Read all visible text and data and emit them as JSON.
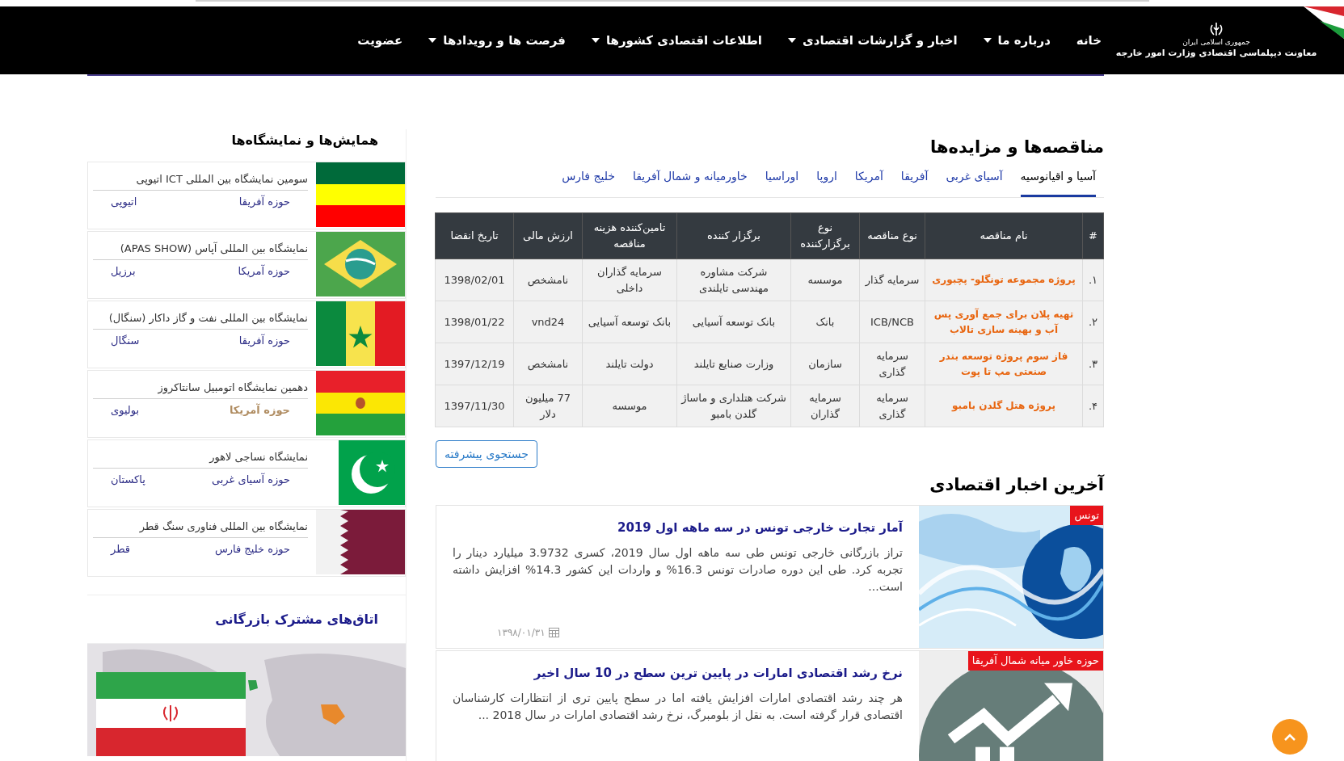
{
  "header": {
    "logo": {
      "line_1": "جمهوری اسلامی ایران",
      "line_2": "معاونت دیپلماسی اقتصادی وزارت امور خارجه"
    },
    "nav": [
      {
        "label": "خانه",
        "has_menu": false
      },
      {
        "label": "درباره ما",
        "has_menu": true
      },
      {
        "label": "اخبار و گزارشات اقتصادی",
        "has_menu": true
      },
      {
        "label": "اطلاعات اقتصادی کشورها",
        "has_menu": true
      },
      {
        "label": "فرصت ها و رویدادها",
        "has_menu": true
      },
      {
        "label": "عضویت",
        "has_menu": false
      }
    ]
  },
  "tenders": {
    "title": "مناقصه‌ها و مزایده‌ها",
    "tabs": [
      {
        "label": "آسیا و اقیانوسیه",
        "selected": true
      },
      {
        "label": "آسیای غربی",
        "selected": false
      },
      {
        "label": "آفریقا",
        "selected": false
      },
      {
        "label": "آمریکا",
        "selected": false
      },
      {
        "label": "اروپا",
        "selected": false
      },
      {
        "label": "اوراسیا",
        "selected": false
      },
      {
        "label": "خاورمیانه و شمال آفریقا",
        "selected": false
      },
      {
        "label": "خلیج فارس",
        "selected": false
      }
    ],
    "columns": [
      "#",
      "نام مناقصه",
      "نوع مناقصه",
      "نوع برگزارکننده",
      "برگزار کننده",
      "تامین‌کننده هزینه مناقصه",
      "ارزش مالی",
      "تاریخ انقضا"
    ],
    "rows": [
      {
        "number": "۱.",
        "name": "پروژه مجموعه تونگلو- پچبوری",
        "type": "سرمایه گذار",
        "organizer_type": "موسسه",
        "organizer": "شرکت مشاوره مهندسی تایلندی",
        "funder": "سرمایه گذاران داخلی",
        "value": "نامشخص",
        "expiry": "1398/02/01"
      },
      {
        "number": "۲.",
        "name": "تهیه پلان برای جمع آوری پس آب و بهینه سازی تالاب",
        "type": "ICB/NCB",
        "organizer_type": "بانک",
        "organizer": "بانک توسعه آسیایی",
        "funder": "بانک توسعه آسیایی",
        "value": "vnd24",
        "expiry": "1398/01/22"
      },
      {
        "number": "۳.",
        "name": "فاز سوم پروژه توسعه بندر صنعتی مپ تا پوت",
        "type": "سرمایه گذاری",
        "organizer_type": "سازمان",
        "organizer": "وزارت صنایع تایلند",
        "funder": "دولت تایلند",
        "value": "نامشخص",
        "expiry": "1397/12/19"
      },
      {
        "number": "۴.",
        "name": "پروژه هتل گلدن بامبو",
        "type": "سرمایه گذاری",
        "organizer_type": "سرمایه گذاران",
        "organizer": "شرکت هتلداری و ماساژ گلدن بامبو",
        "funder": "موسسه",
        "value": "77 میلیون دلار",
        "expiry": "1397/11/30"
      }
    ],
    "advanced_search_button": "جستجوی پیشرفته"
  },
  "news": {
    "title": "آخرین اخبار اقتصادی",
    "items": [
      {
        "kind": "globe",
        "tag": "تونس",
        "title": "آمار تجارت خارجی تونس در سه ماهه اول 2019",
        "excerpt": "تراز بازرگانی خارجی تونس طی سه ماهه اول سال 2019، کسری 3.9732 میلیارد دینار را تجربه کرد. طی این دوره صادرات تونس 16.3% و واردات این کشور 14.3% افزایش داشته است...",
        "date": "۱۳۹۸/۰۱/۳۱"
      },
      {
        "kind": "growth",
        "tag": "حوزه خاور میانه شمال آفریقا",
        "title": "نرخ رشد اقتصادی امارات در پایین ترین سطح در 10 سال اخیر",
        "excerpt": "هر چند رشد اقتصادی امارات افزایش یافته اما در سطح پایین تری از انتظارات کارشناسان اقتصادی قرار گرفته است. به نقل از بلومبرگ، نرخ رشد اقتصادی امارات در سال 2018 ..."
      }
    ]
  },
  "sidebar": {
    "exhibitions": {
      "title": "همایش‌ها و نمایشگاه‌ها",
      "items": [
        {
          "kind": "ethiopia",
          "title": "سومین نمایشگاه بین المللی ICT اتیوپی",
          "region": "حوزه آفریقا",
          "region_highlighted": false,
          "country": "اتیوپی"
        },
        {
          "kind": "brazil",
          "title": "نمایشگاه بین المللی آپاس (APAS SHOW)",
          "region": "حوزه آمریکا",
          "region_highlighted": false,
          "country": "برزیل"
        },
        {
          "kind": "senegal",
          "title": "نمایشگاه بین المللی نفت و گاز داکار (سنگال)",
          "region": "حوزه آفریقا",
          "region_highlighted": false,
          "country": "سنگال"
        },
        {
          "kind": "bolivia",
          "title": "دهمین نمایشگاه اتومبیل سانتاکروز",
          "region": "حوزه آمریکا",
          "region_highlighted": true,
          "country": "بولیوی"
        },
        {
          "kind": "pakistan",
          "title": "نمایشگاه نساجی لاهور",
          "region": "حوزه آسیای غربی",
          "region_highlighted": false,
          "country": "پاکستان"
        },
        {
          "kind": "qatar",
          "title": "نمایشگاه بین المللی فناوری سنگ قطر",
          "region": "حوزه خلیج فارس",
          "region_highlighted": false,
          "country": "قطر"
        }
      ]
    },
    "chambers": {
      "title": "اتاق‌های مشترک بازرگانی"
    }
  }
}
